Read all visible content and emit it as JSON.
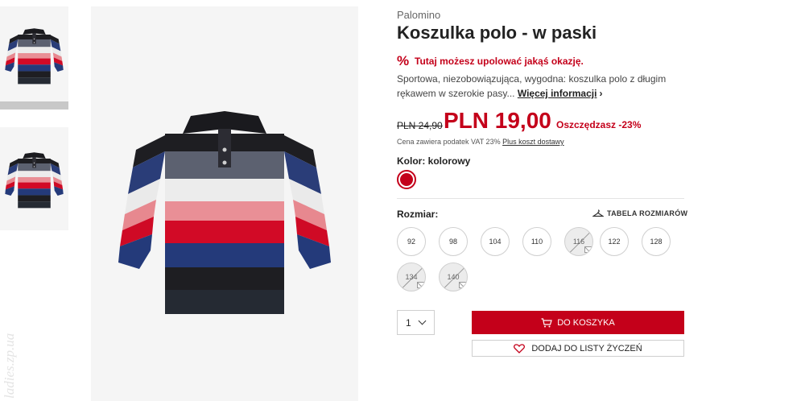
{
  "thumbnails": [
    {
      "alt": "product-thumbnail-front",
      "active": true
    },
    {
      "alt": "product-thumbnail-back",
      "active": false
    }
  ],
  "watermark": "ladies.zp.ua",
  "product": {
    "brand": "Palomino",
    "title": "Koszulka polo - w paski"
  },
  "deal": {
    "icon": "percent-icon",
    "text": "Tutaj możesz upolować jakąś okazję."
  },
  "description": {
    "text": "Sportowa, niezobowiązująca, wygodna: koszulka polo z długim rękawem w szerokie pasy...",
    "more_link": "Więcej informacji"
  },
  "price": {
    "old": "PLN 24,90",
    "current": "PLN 19,00",
    "savings": "Oszczędzasz -23%",
    "vat_note": "Cena zawiera podatek VAT 23%",
    "shipping_link": "Plus koszt dostawy"
  },
  "color": {
    "label": "Kolor: kolorowy",
    "swatch_color": "#c4001a"
  },
  "size": {
    "label": "Rozmiar:",
    "table_link": "TABELA ROZMIARÓW",
    "options": [
      {
        "value": "92",
        "available": true
      },
      {
        "value": "98",
        "available": true
      },
      {
        "value": "104",
        "available": true
      },
      {
        "value": "110",
        "available": true
      },
      {
        "value": "116",
        "available": false
      },
      {
        "value": "122",
        "available": true
      },
      {
        "value": "128",
        "available": true
      },
      {
        "value": "134",
        "available": false
      },
      {
        "value": "140",
        "available": false
      }
    ]
  },
  "quantity": {
    "value": "1"
  },
  "buttons": {
    "add_to_cart": "DO KOSZYKA",
    "add_to_wishlist": "DODAJ DO LISTY ŻYCZEŃ"
  },
  "colors": {
    "accent": "#c4001a",
    "image_bg": "#f5f5f5"
  }
}
